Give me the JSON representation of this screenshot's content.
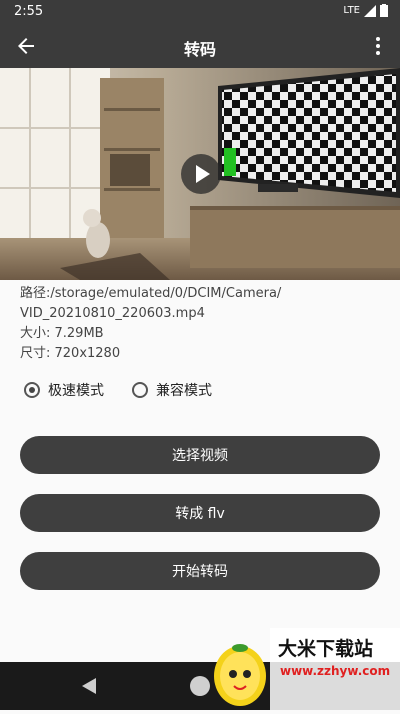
{
  "status": {
    "time": "2:55",
    "network": "LTE"
  },
  "appbar": {
    "title": "转码"
  },
  "video": {},
  "file": {
    "path_line1": "路径:/storage/emulated/0/DCIM/Camera/",
    "path_line2": "VID_20210810_220603.mp4",
    "size": "大小: 7.29MB",
    "dimensions": "尺寸: 720x1280"
  },
  "modes": {
    "fast": "极速模式",
    "compatible": "兼容模式",
    "selected": "fast"
  },
  "buttons": {
    "select_video": "选择视频",
    "convert_flv": "转成 flv",
    "start": "开始转码"
  },
  "watermark": {
    "name": "大米下载站",
    "url": "www.zzhyw.com"
  }
}
